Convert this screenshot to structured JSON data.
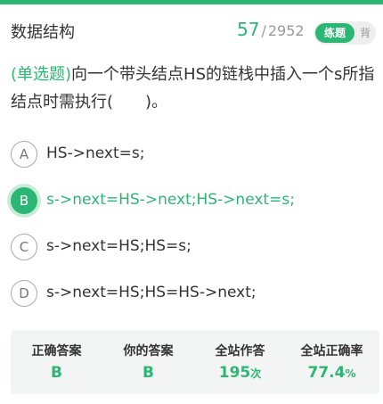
{
  "header": {
    "title": "数据结构",
    "current": "57",
    "separator": "/",
    "total": "2952",
    "mode_active": "练题",
    "mode_inactive": "背"
  },
  "question": {
    "type_label": "(单选题)",
    "text": "向一个带头结点HS的链栈中插入一个s所指结点时需执行(　　)。"
  },
  "options": [
    {
      "letter": "A",
      "text": "HS->next=s;"
    },
    {
      "letter": "B",
      "text": "s->next=HS->next;HS->next=s;"
    },
    {
      "letter": "C",
      "text": "s->next=HS;HS=s;"
    },
    {
      "letter": "D",
      "text": "s->next=HS;HS=HS->next;"
    }
  ],
  "selected_option": "B",
  "stats": {
    "correct_answer_label": "正确答案",
    "correct_answer": "B",
    "your_answer_label": "你的答案",
    "your_answer": "B",
    "attempts_label": "全站作答",
    "attempts": "195",
    "attempts_unit": "次",
    "accuracy_label": "全站正确率",
    "accuracy": "77.4",
    "accuracy_unit": "%"
  },
  "colors": {
    "accent": "#2bb673",
    "stats_bg": "#f3f5f4"
  }
}
